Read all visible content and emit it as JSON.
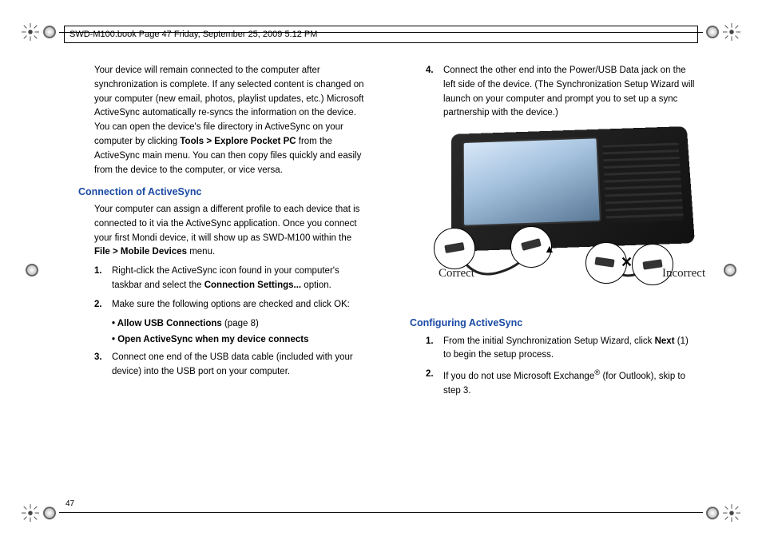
{
  "header": "SWD-M100.book  Page 47  Friday, September 25, 2009  5:12 PM",
  "pageNumber": "47",
  "intro": {
    "part1": "Your device will remain connected to the computer after synchronization is complete. If any selected content is changed on your computer (new email, photos, playlist updates, etc.) Microsoft ActiveSync automatically re-syncs the information on the device. You can open the device's file directory in ActiveSync on your computer by clicking ",
    "bold1": "Tools > Explore Pocket PC",
    "part2": " from the ActiveSync main menu. You can then copy files quickly and easily from the device to the computer, or vice versa."
  },
  "section1": {
    "title": "Connection of ActiveSync",
    "body_part1": "Your computer can assign a different profile to each device that is connected to it via the ActiveSync application. Once you connect your first Mondi device, it will show up as SWD-M100 within the ",
    "body_bold": "File > Mobile Devices",
    "body_part2": " menu."
  },
  "steps1": [
    {
      "n": "1.",
      "t1": "Right-click the ActiveSync icon found in your computer's taskbar and select the ",
      "b": "Connection Settings...",
      "t2": " option."
    },
    {
      "n": "2.",
      "t1": "Make sure the following options are checked and click OK:",
      "b": "",
      "t2": ""
    }
  ],
  "bullets": [
    {
      "b": "Allow USB Connections",
      "t": " (page 8)"
    },
    {
      "b": "Open ActiveSync when my device connects",
      "t": ""
    }
  ],
  "steps1b": [
    {
      "n": "3.",
      "t": "Connect one end of the USB data cable (included with your device) into the USB port on your computer."
    }
  ],
  "steps2_top": [
    {
      "n": "4.",
      "t": "Connect the other end into the Power/USB Data jack on the left side of the device. (The Synchronization Setup Wizard will launch on your computer and prompt you to set up a sync partnership with the device.)"
    }
  ],
  "figure": {
    "correct": "Correct",
    "incorrect": "Incorrect"
  },
  "section2": {
    "title": "Configuring ActiveSync"
  },
  "steps3": [
    {
      "n": "1.",
      "t1": "From the initial Synchronization Setup Wizard, click ",
      "b": "Next",
      "t2": " (1) to begin the setup process."
    },
    {
      "n": "2.",
      "t1": "If you do not use Microsoft Exchange",
      "sup": "®",
      "t2": " (for Outlook), skip to step 3."
    }
  ]
}
